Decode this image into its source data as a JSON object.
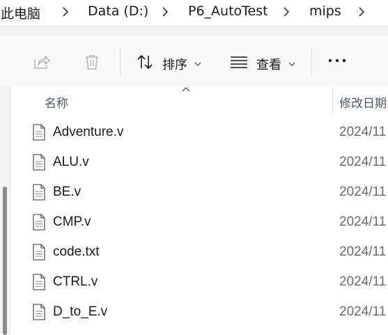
{
  "breadcrumb": {
    "items": [
      "此电脑",
      "Data (D:)",
      "P6_AutoTest",
      "mips"
    ]
  },
  "toolbar": {
    "share_icon": "share-icon",
    "delete_icon": "trash-icon",
    "sort_label": "排序",
    "view_label": "查看",
    "more_label": "•••"
  },
  "columns": {
    "name": "名称",
    "modified": "修改日期"
  },
  "files": [
    {
      "name": "Adventure.v",
      "date": "2024/11"
    },
    {
      "name": "ALU.v",
      "date": "2024/11"
    },
    {
      "name": "BE.v",
      "date": "2024/11"
    },
    {
      "name": "CMP.v",
      "date": "2024/11"
    },
    {
      "name": "code.txt",
      "date": "2024/11"
    },
    {
      "name": "CTRL.v",
      "date": "2024/11"
    },
    {
      "name": "D_to_E.v",
      "date": "2024/11"
    }
  ],
  "colors": {
    "toolbar_bg": "#f9f9f9",
    "disabled_icon": "#b5b5b5",
    "text": "#1a1a1a"
  }
}
